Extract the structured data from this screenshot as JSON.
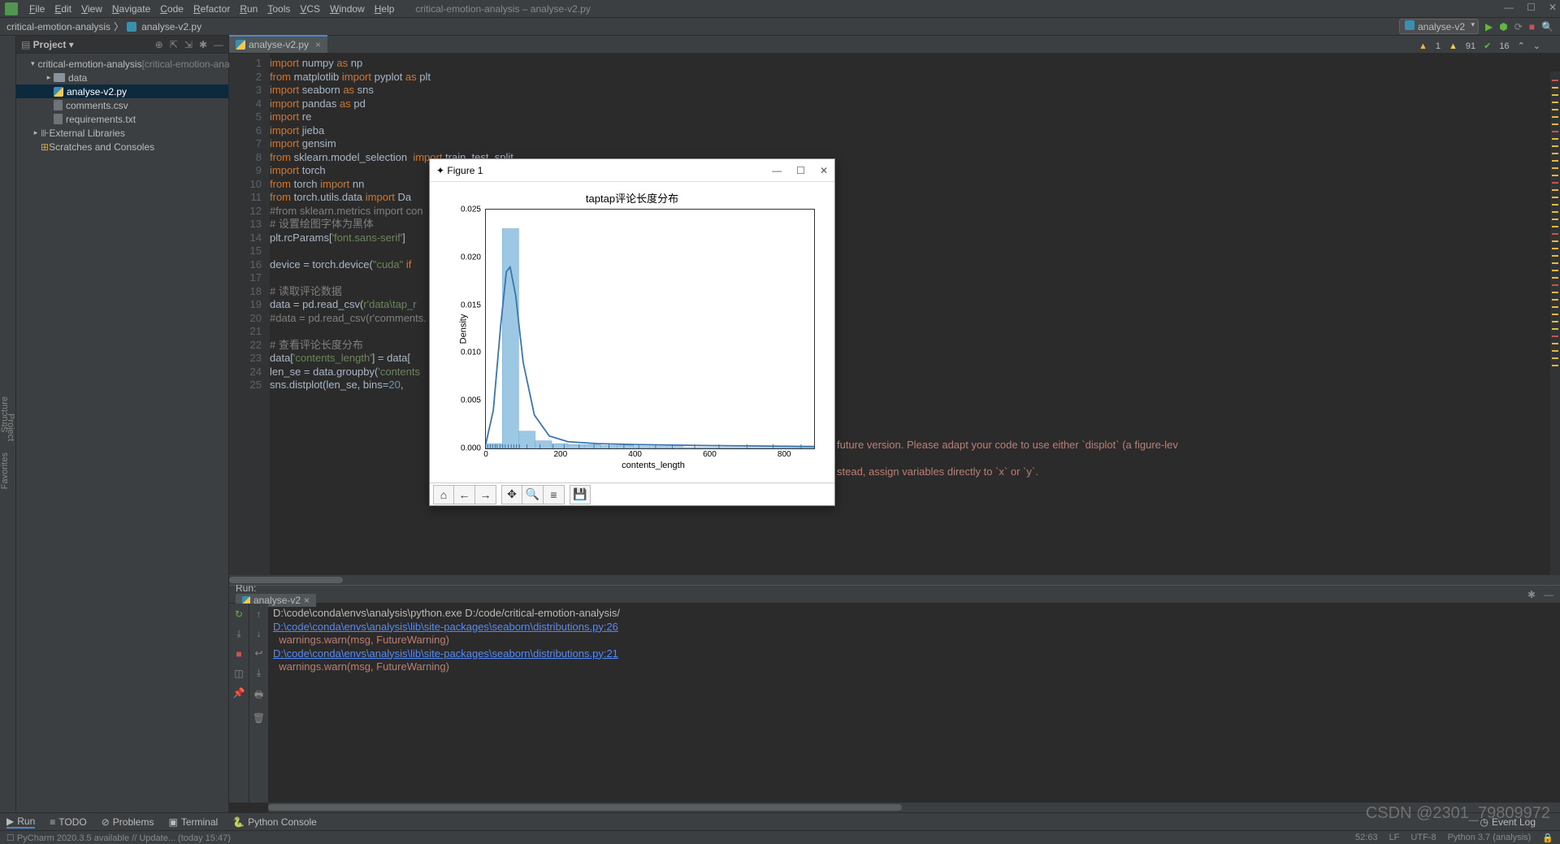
{
  "window_title": "critical-emotion-analysis – analyse-v2.py",
  "menu": [
    "File",
    "Edit",
    "View",
    "Navigate",
    "Code",
    "Refactor",
    "Run",
    "Tools",
    "VCS",
    "Window",
    "Help"
  ],
  "breadcrumb": {
    "project": "critical-emotion-analysis",
    "file": "analyse-v2.py"
  },
  "run_config": "analyse-v2",
  "project_panel": {
    "title": "Project",
    "root": "critical-emotion-analysis",
    "root_hint": "[critical-emotion-analysis]",
    "data_folder": "data",
    "files": [
      "analyse-v2.py",
      "comments.csv",
      "requirements.txt"
    ],
    "external": "External Libraries",
    "scratches": "Scratches and Consoles"
  },
  "editor_tab": "analyse-v2.py",
  "inspection": {
    "warn": "1",
    "err": "91",
    "ok": "16"
  },
  "code_lines": [
    {
      "n": 1,
      "html": "<span class='kw'>import</span> numpy <span class='kw'>as</span> np"
    },
    {
      "n": 2,
      "html": "<span class='kw'>from</span> matplotlib <span class='kw'>import</span> pyplot <span class='kw'>as</span> plt"
    },
    {
      "n": 3,
      "html": "<span class='kw'>import</span> seaborn <span class='kw'>as</span> sns"
    },
    {
      "n": 4,
      "html": "<span class='kw'>import</span> pandas <span class='kw'>as</span> pd"
    },
    {
      "n": 5,
      "html": "<span class='kw'>import</span> re"
    },
    {
      "n": 6,
      "html": "<span class='kw'>import</span> jieba"
    },
    {
      "n": 7,
      "html": "<span class='kw'>import</span> gensim"
    },
    {
      "n": 8,
      "html": "<span class='kw'>from</span> sklearn.model_selection  <span class='kw'>import</span> train_test_split"
    },
    {
      "n": 9,
      "html": "<span class='kw'>import</span> torch"
    },
    {
      "n": 10,
      "html": "<span class='kw'>from</span> torch <span class='kw'>import</span> nn"
    },
    {
      "n": 11,
      "html": "<span class='kw'>from</span> torch.utils.data <span class='kw'>import</span> Da"
    },
    {
      "n": 12,
      "html": "<span class='cmt'>#from sklearn.metrics import con</span>"
    },
    {
      "n": 13,
      "html": "<span class='cmt'># 设置绘图字体为黑体</span>"
    },
    {
      "n": 14,
      "html": "plt.rcParams[<span class='str'>'font.sans-serif'</span>]"
    },
    {
      "n": 15,
      "html": ""
    },
    {
      "n": 16,
      "html": "device = torch.device(<span class='str'>\"cuda\"</span> <span class='kw'>if</span>"
    },
    {
      "n": 17,
      "html": ""
    },
    {
      "n": 18,
      "html": "<span class='cmt'># 读取评论数据</span>"
    },
    {
      "n": 19,
      "html": "data = pd.read_csv(<span class='str'>r'data\\tap_r</span>"
    },
    {
      "n": 20,
      "html": "<span class='cmt'>#data = pd.read_csv(r'comments.</span>"
    },
    {
      "n": 21,
      "html": ""
    },
    {
      "n": 22,
      "html": "<span class='cmt'># 查看评论长度分布</span>"
    },
    {
      "n": 23,
      "html": "data[<span class='str'>'contents_length'</span>] = data["
    },
    {
      "n": 24,
      "html": "len_se = data.groupby(<span class='str'>'contents</span>"
    },
    {
      "n": 25,
      "html": "sns.distplot(len_se, <span>bins</span>=<span class='num'>20</span>, "
    }
  ],
  "run_panel": {
    "title": "Run:",
    "tab": "analyse-v2",
    "lines": [
      {
        "cls": "",
        "text": "D:\\code\\conda\\envs\\analysis\\python.exe D:/code/critical-emotion-analysis/"
      },
      {
        "cls": "link",
        "text": "D:\\code\\conda\\envs\\analysis\\lib\\site-packages\\seaborn\\distributions.py:26"
      },
      {
        "cls": "warn",
        "text": "  warnings.warn(msg, FutureWarning)"
      },
      {
        "cls": "link",
        "text": "D:\\code\\conda\\envs\\analysis\\lib\\site-packages\\seaborn\\distributions.py:21"
      },
      {
        "cls": "warn",
        "text": "  warnings.warn(msg, FutureWarning)"
      }
    ],
    "overflow_right_1": "future version. Please adapt your code to use either `displot` (a figure-lev",
    "overflow_right_2": "stead, assign variables directly to `x` or `y`."
  },
  "bottom_tabs": {
    "run": "Run",
    "todo": "TODO",
    "problems": "Problems",
    "terminal": "Terminal",
    "pyconsole": "Python Console",
    "eventlog": "Event Log"
  },
  "status_bar": {
    "left": "PyCharm 2020.3.5 available // Update... (today 15:47)",
    "pos": "52:63",
    "enc": "LF",
    "charset": "UTF-8",
    "interp": "Python 3.7 (analysis)"
  },
  "figure": {
    "window_title": "Figure 1",
    "toolbar": [
      "home",
      "back",
      "forward",
      "pan",
      "zoom",
      "config",
      "save"
    ]
  },
  "chart_data": {
    "type": "hist+kde",
    "title": "taptap评论长度分布",
    "xlabel": "contents_length",
    "ylabel": "Density",
    "xlim": [
      0,
      880
    ],
    "ylim": [
      0,
      0.025
    ],
    "xticks": [
      0,
      200,
      400,
      600,
      800
    ],
    "yticks": [
      0.0,
      0.005,
      0.01,
      0.015,
      0.02,
      0.025
    ],
    "bars": [
      {
        "x": 0,
        "w": 44,
        "y": 0.0005
      },
      {
        "x": 44,
        "w": 44,
        "y": 0.023
      },
      {
        "x": 88,
        "w": 44,
        "y": 0.0018
      },
      {
        "x": 132,
        "w": 44,
        "y": 0.0008
      },
      {
        "x": 176,
        "w": 44,
        "y": 0.0005
      },
      {
        "x": 220,
        "w": 44,
        "y": 0.0004
      },
      {
        "x": 264,
        "w": 44,
        "y": 0.0004
      },
      {
        "x": 308,
        "w": 44,
        "y": 0.0003
      },
      {
        "x": 352,
        "w": 44,
        "y": 0.0003
      },
      {
        "x": 396,
        "w": 44,
        "y": 0.0002
      },
      {
        "x": 440,
        "w": 44,
        "y": 0.0002
      },
      {
        "x": 484,
        "w": 44,
        "y": 0.0002
      },
      {
        "x": 528,
        "w": 44,
        "y": 0.0001
      },
      {
        "x": 572,
        "w": 44,
        "y": 0.0001
      },
      {
        "x": 616,
        "w": 44,
        "y": 0.0001
      },
      {
        "x": 660,
        "w": 44,
        "y": 0.0001
      },
      {
        "x": 704,
        "w": 44,
        "y": 0.0001
      },
      {
        "x": 748,
        "w": 44,
        "y": 0.0001
      },
      {
        "x": 792,
        "w": 44,
        "y": 0.0001
      },
      {
        "x": 836,
        "w": 44,
        "y": 0.0001
      }
    ],
    "kde": [
      {
        "x": 0,
        "y": 0.0005
      },
      {
        "x": 20,
        "y": 0.004
      },
      {
        "x": 40,
        "y": 0.013
      },
      {
        "x": 55,
        "y": 0.0185
      },
      {
        "x": 65,
        "y": 0.019
      },
      {
        "x": 80,
        "y": 0.016
      },
      {
        "x": 100,
        "y": 0.009
      },
      {
        "x": 130,
        "y": 0.0035
      },
      {
        "x": 170,
        "y": 0.0013
      },
      {
        "x": 220,
        "y": 0.0007
      },
      {
        "x": 300,
        "y": 0.0005
      },
      {
        "x": 400,
        "y": 0.0004
      },
      {
        "x": 600,
        "y": 0.0003
      },
      {
        "x": 880,
        "y": 0.0002
      }
    ],
    "rug": [
      5,
      12,
      18,
      25,
      30,
      38,
      45,
      52,
      60,
      68,
      75,
      82,
      90,
      110,
      145,
      180,
      210,
      250,
      290,
      330,
      370,
      410,
      455,
      500,
      560,
      625,
      700,
      770,
      845
    ]
  },
  "watermark": "CSDN @2301_79809972",
  "sidebar_labels": [
    "Structure",
    "Favorites"
  ]
}
